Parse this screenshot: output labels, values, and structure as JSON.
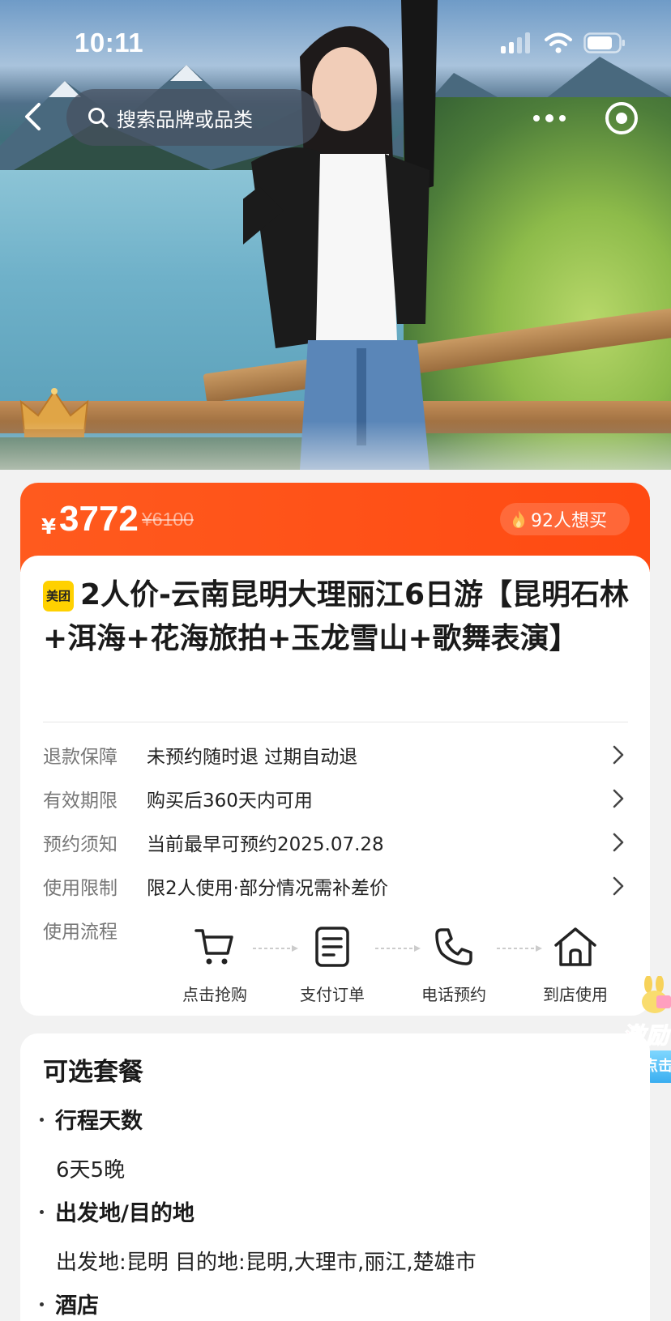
{
  "status": {
    "time": "10:11"
  },
  "nav": {
    "search_placeholder": "搜索品牌或品类"
  },
  "price": {
    "currency": "¥",
    "current": "3772",
    "original": "¥6100",
    "want_count": "92人想买"
  },
  "product": {
    "badge": "美团",
    "title": "2人价-云南昆明大理丽江6日游【昆明石林+洱海+花海旅拍+玉龙雪山+歌舞表演】"
  },
  "info_rows": [
    {
      "label": "退款保障",
      "value": "未预约随时退 过期自动退"
    },
    {
      "label": "有效期限",
      "value": "购买后360天内可用"
    },
    {
      "label": "预约须知",
      "value": "当前最早可预约2025.07.28"
    },
    {
      "label": "使用限制",
      "value": "限2人使用·部分情况需补差价"
    }
  ],
  "flow": {
    "label": "使用流程",
    "steps": [
      {
        "label": "点击抢购",
        "icon": "cart-icon"
      },
      {
        "label": "支付订单",
        "icon": "order-icon"
      },
      {
        "label": "电话预约",
        "icon": "phone-icon"
      },
      {
        "label": "到店使用",
        "icon": "store-icon"
      }
    ]
  },
  "side_promo": {
    "text": "激励",
    "button": "点击"
  },
  "options": {
    "title": "可选套餐",
    "sections": [
      {
        "heading": "行程天数",
        "value": "6天5晚"
      },
      {
        "heading": "出发地/目的地",
        "value": "出发地:昆明 目的地:昆明,大理市,丽江,楚雄市"
      },
      {
        "heading": "酒店"
      }
    ]
  },
  "colors": {
    "accent": "#ff4a12",
    "meituan_yellow": "#ffd100"
  }
}
